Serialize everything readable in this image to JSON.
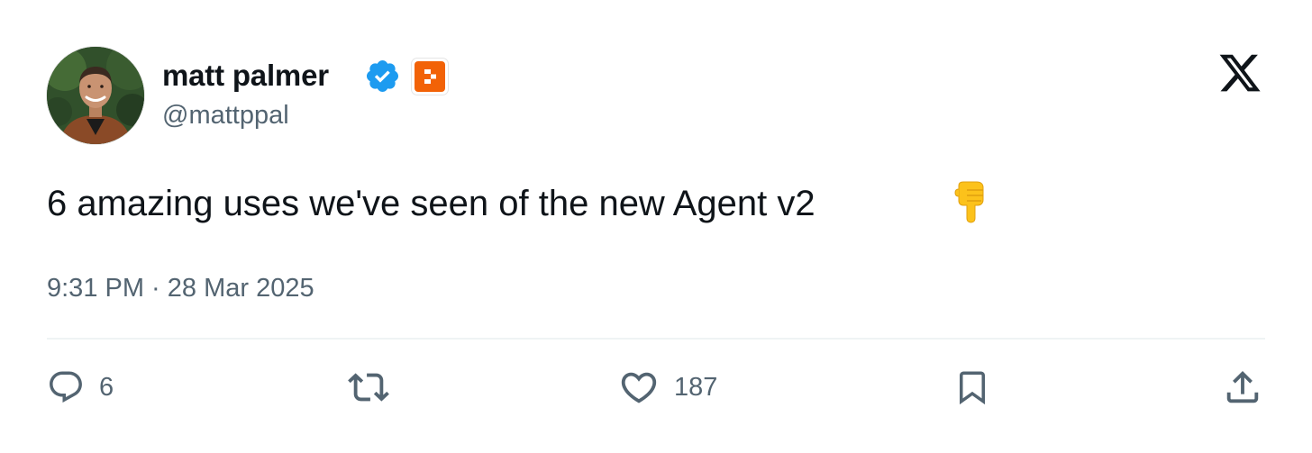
{
  "tweet": {
    "author": {
      "name": "matt palmer",
      "handle": "@mattppal",
      "verified": true,
      "affiliate_badge_color": "#f26207",
      "verified_color": "#1d9bf0"
    },
    "platform_logo": "x-logo-icon",
    "text": "6 amazing uses we've seen of the new Agent v2",
    "emoji": "backhand-index-pointing-down",
    "timestamp": "9:31 PM · 28 Mar 2025",
    "actions": {
      "reply": {
        "icon": "reply-icon",
        "count": "6"
      },
      "retweet": {
        "icon": "retweet-icon",
        "count": ""
      },
      "like": {
        "icon": "heart-icon",
        "count": "187"
      },
      "bookmark": {
        "icon": "bookmark-icon"
      },
      "share": {
        "icon": "share-icon"
      }
    }
  },
  "colors": {
    "text_primary": "#0f1419",
    "text_secondary": "#536471",
    "divider": "#eff3f4"
  }
}
